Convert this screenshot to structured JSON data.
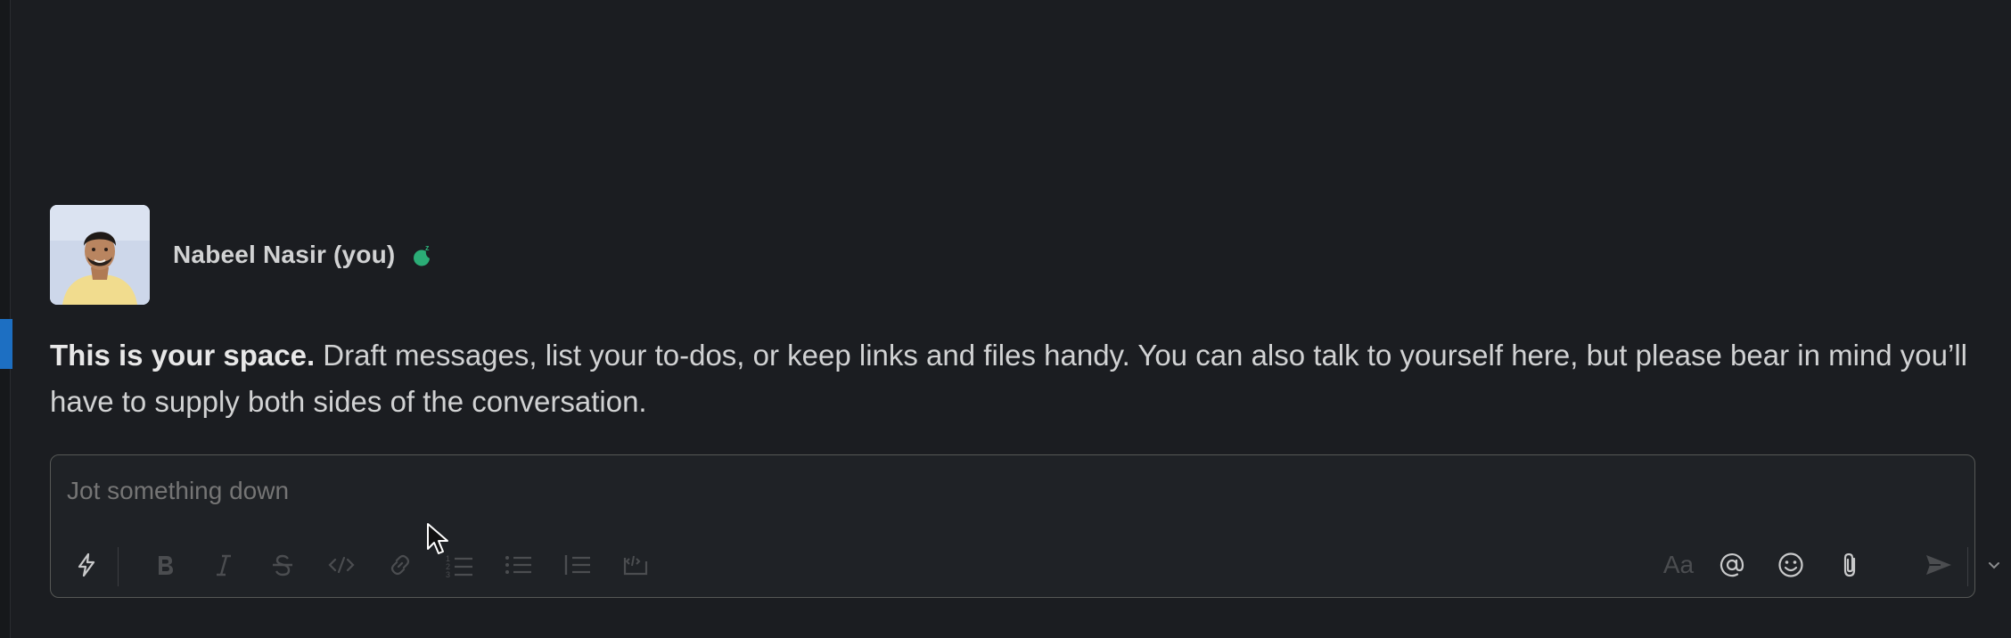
{
  "profile": {
    "display_name": "Nabeel Nasir (you)",
    "avatar_alt": "Nabeel Nasir",
    "status_icon": "snooze-icon"
  },
  "intro": {
    "lead": "This is your space.",
    "body": " Draft messages, list your to-dos, or keep links and files handy. You can also talk to yourself here, but please bear in mind you’ll have to supply both sides of the conversation."
  },
  "composer": {
    "placeholder": "Jot something down",
    "value": "",
    "text_format_label": "Aa",
    "toolbar": [
      {
        "name": "shortcuts-icon",
        "enabled": true
      },
      {
        "name": "bold-icon",
        "enabled": false
      },
      {
        "name": "italic-icon",
        "enabled": false
      },
      {
        "name": "strikethrough-icon",
        "enabled": false
      },
      {
        "name": "code-icon",
        "enabled": false
      },
      {
        "name": "link-icon",
        "enabled": false
      },
      {
        "name": "ordered-list-icon",
        "enabled": false
      },
      {
        "name": "bulleted-list-icon",
        "enabled": false
      },
      {
        "name": "blockquote-icon",
        "enabled": false
      },
      {
        "name": "code-block-icon",
        "enabled": false
      },
      {
        "name": "formatting-toggle",
        "enabled": false
      },
      {
        "name": "mention-icon",
        "enabled": true
      },
      {
        "name": "emoji-icon",
        "enabled": true
      },
      {
        "name": "attach-icon",
        "enabled": true
      },
      {
        "name": "send-icon",
        "enabled": false
      },
      {
        "name": "send-options-chevron-icon",
        "enabled": true
      }
    ]
  },
  "colors": {
    "background": "#1b1d21",
    "text": "#d1d2d3",
    "placeholder": "#7c7d80",
    "disabled_icon": "#4b4d50",
    "enabled_icon": "#c8c9ca",
    "status_green": "#2bac76",
    "accent_blue": "#1d6fc2"
  }
}
